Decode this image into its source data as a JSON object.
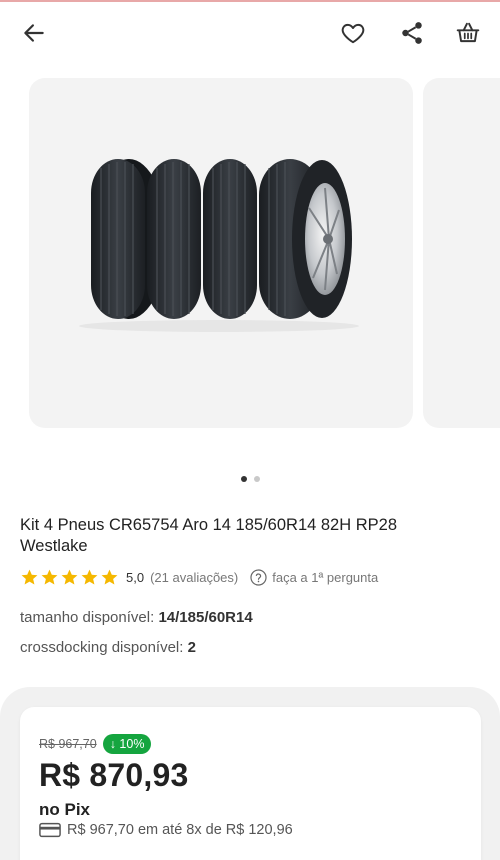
{
  "header": {
    "back_icon": "arrow-left-icon",
    "favorite_icon": "heart-icon",
    "share_icon": "share-icon",
    "cart_icon": "basket-icon"
  },
  "gallery": {
    "image": "four-tires-image",
    "dots_count": 2,
    "active_dot": 0
  },
  "product": {
    "title": "Kit 4 Pneus CR65754 Aro 14 185/60R14 82H RP28 Westlake",
    "rating": {
      "stars": 5,
      "score": "5,0",
      "reviews": "(21 avaliações)",
      "question": "faça a 1ª pergunta"
    },
    "specs": [
      {
        "label": "tamanho disponível:",
        "value": "14/185/60R14"
      },
      {
        "label": "crossdocking disponível:",
        "value": "2"
      }
    ]
  },
  "pricing": {
    "old_price": "R$ 967,70",
    "discount": "↓ 10%",
    "price": "R$ 870,93",
    "price_note": "no Pix",
    "installments": "R$ 967,70 em até 8x de R$ 120,96",
    "colors": {
      "discount_bg": "#15a53f",
      "star": "#f5b800"
    }
  }
}
